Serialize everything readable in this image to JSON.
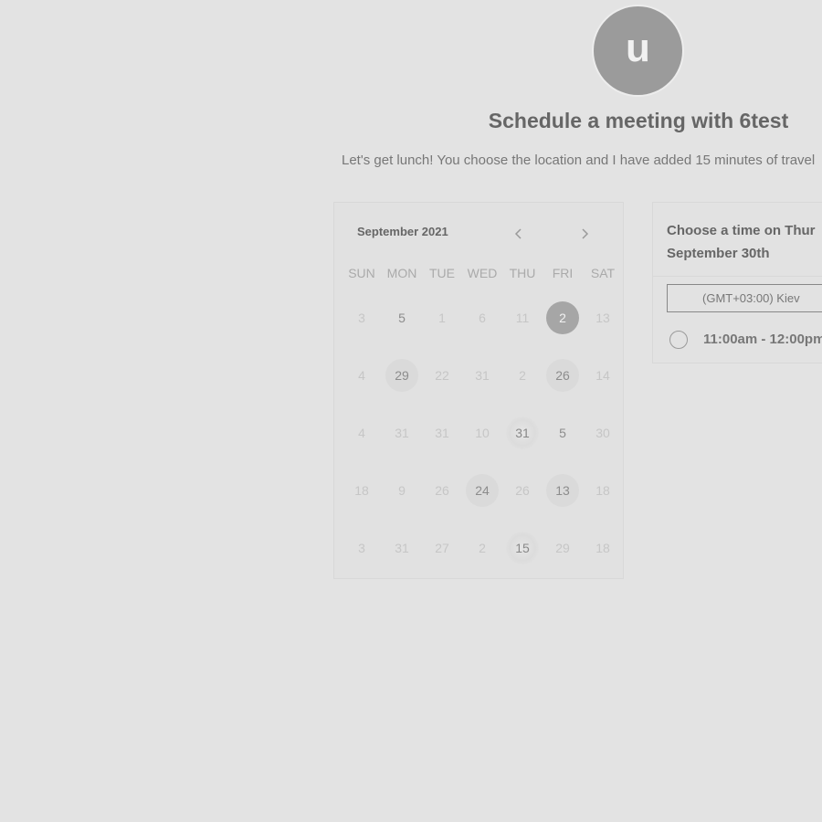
{
  "avatar": {
    "initial": "u"
  },
  "header": {
    "title": "Schedule a meeting with 6test",
    "description": "Let's get lunch! You choose the location and I have added 15 minutes of travel"
  },
  "calendar": {
    "month_label": "September 2021",
    "prev_icon": "chevron-left-icon",
    "next_icon": "chevron-right-icon",
    "weekdays": [
      "SUN",
      "MON",
      "TUE",
      "WED",
      "THU",
      "FRI",
      "SAT"
    ],
    "weeks": [
      [
        {
          "label": "3",
          "state": "disabled"
        },
        {
          "label": "5",
          "state": "available"
        },
        {
          "label": "1",
          "state": "disabled"
        },
        {
          "label": "6",
          "state": "disabled"
        },
        {
          "label": "11",
          "state": "disabled"
        },
        {
          "label": "2",
          "state": "selected"
        },
        {
          "label": "13",
          "state": "disabled"
        }
      ],
      [
        {
          "label": "4",
          "state": "disabled"
        },
        {
          "label": "29",
          "state": "soft"
        },
        {
          "label": "22",
          "state": "disabled"
        },
        {
          "label": "31",
          "state": "disabled"
        },
        {
          "label": "2",
          "state": "disabled"
        },
        {
          "label": "26",
          "state": "soft"
        },
        {
          "label": "14",
          "state": "disabled"
        }
      ],
      [
        {
          "label": "4",
          "state": "disabled"
        },
        {
          "label": "31",
          "state": "disabled"
        },
        {
          "label": "31",
          "state": "disabled"
        },
        {
          "label": "10",
          "state": "disabled"
        },
        {
          "label": "31",
          "state": "dotted"
        },
        {
          "label": "5",
          "state": "available"
        },
        {
          "label": "30",
          "state": "disabled"
        }
      ],
      [
        {
          "label": "18",
          "state": "disabled"
        },
        {
          "label": "9",
          "state": "disabled"
        },
        {
          "label": "26",
          "state": "disabled"
        },
        {
          "label": "24",
          "state": "soft"
        },
        {
          "label": "26",
          "state": "disabled"
        },
        {
          "label": "13",
          "state": "soft"
        },
        {
          "label": "18",
          "state": "disabled"
        }
      ],
      [
        {
          "label": "3",
          "state": "disabled"
        },
        {
          "label": "31",
          "state": "disabled"
        },
        {
          "label": "27",
          "state": "disabled"
        },
        {
          "label": "2",
          "state": "disabled"
        },
        {
          "label": "15",
          "state": "dotted"
        },
        {
          "label": "29",
          "state": "disabled"
        },
        {
          "label": "18",
          "state": "disabled"
        }
      ]
    ]
  },
  "time_panel": {
    "heading_line1": "Choose a time on Thur",
    "heading_line2": "September 30th",
    "timezone": "(GMT+03:00) Kiev",
    "slots": [
      {
        "label": "11:00am - 12:00pm"
      }
    ]
  },
  "colors": {
    "background": "#e3e3e3",
    "selected_day": "#a6a6a6",
    "avatar": "#9b9b9b"
  }
}
